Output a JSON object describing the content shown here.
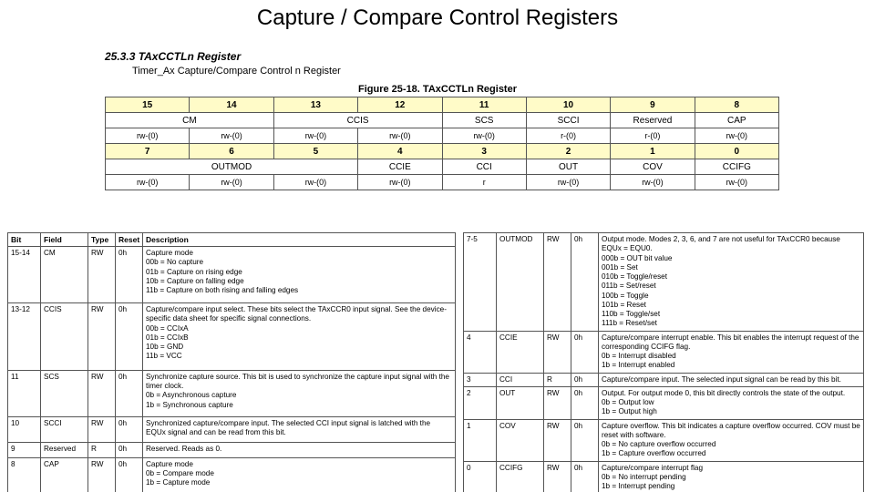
{
  "title": "Capture / Compare Control Registers",
  "section_num": "25.3.3   TAxCCTLn Register",
  "section_sub": "Timer_Ax Capture/Compare Control n Register",
  "figure_caption": "Figure 25-18. TAxCCTLn Register",
  "reg_high": {
    "bits": [
      "15",
      "14",
      "13",
      "12",
      "11",
      "10",
      "9",
      "8"
    ],
    "fields": [
      {
        "label": "CM",
        "span": 2
      },
      {
        "label": "CCIS",
        "span": 2
      },
      {
        "label": "SCS",
        "span": 1
      },
      {
        "label": "SCCI",
        "span": 1
      },
      {
        "label": "Reserved",
        "span": 1
      },
      {
        "label": "CAP",
        "span": 1
      }
    ],
    "access": [
      "rw-(0)",
      "rw-(0)",
      "rw-(0)",
      "rw-(0)",
      "rw-(0)",
      "r-(0)",
      "r-(0)",
      "rw-(0)"
    ]
  },
  "reg_low": {
    "bits": [
      "7",
      "6",
      "5",
      "4",
      "3",
      "2",
      "1",
      "0"
    ],
    "fields": [
      {
        "label": "OUTMOD",
        "span": 3
      },
      {
        "label": "CCIE",
        "span": 1
      },
      {
        "label": "CCI",
        "span": 1
      },
      {
        "label": "OUT",
        "span": 1
      },
      {
        "label": "COV",
        "span": 1
      },
      {
        "label": "CCIFG",
        "span": 1
      }
    ],
    "access": [
      "rw-(0)",
      "rw-(0)",
      "rw-(0)",
      "rw-(0)",
      "r",
      "rw-(0)",
      "rw-(0)",
      "rw-(0)"
    ]
  },
  "desc_headers": [
    "Bit",
    "Field",
    "Type",
    "Reset",
    "Description"
  ],
  "desc_left": [
    {
      "bit": "15-14",
      "field": "CM",
      "type": "RW",
      "reset": "0h",
      "lines": [
        "Capture mode",
        "00b = No capture",
        "01b = Capture on rising edge",
        "10b = Capture on falling edge",
        "11b = Capture on both rising and falling edges"
      ]
    },
    {
      "bit": "13-12",
      "field": "CCIS",
      "type": "RW",
      "reset": "0h",
      "lines": [
        "Capture/compare input select. These bits select the TAxCCR0 input signal. See the device-specific data sheet for specific signal connections.",
        "00b = CCIxA",
        "01b = CCIxB",
        "10b = GND",
        "11b = VCC"
      ]
    },
    {
      "bit": "11",
      "field": "SCS",
      "type": "RW",
      "reset": "0h",
      "lines": [
        "Synchronize capture source. This bit is used to synchronize the capture input signal with the timer clock.",
        "0b = Asynchronous capture",
        "1b = Synchronous capture"
      ]
    },
    {
      "bit": "10",
      "field": "SCCI",
      "type": "RW",
      "reset": "0h",
      "lines": [
        "Synchronized capture/compare input. The selected CCI input signal is latched with the EQUx signal and can be read from this bit."
      ]
    },
    {
      "bit": "9",
      "field": "Reserved",
      "type": "R",
      "reset": "0h",
      "lines": [
        "Reserved. Reads as 0."
      ]
    },
    {
      "bit": "8",
      "field": "CAP",
      "type": "RW",
      "reset": "0h",
      "lines": [
        "Capture mode",
        "0b = Compare mode",
        "1b = Capture mode"
      ]
    }
  ],
  "desc_right": [
    {
      "bit": "7-5",
      "field": "OUTMOD",
      "type": "RW",
      "reset": "0h",
      "lines": [
        "Output mode. Modes 2, 3, 6, and 7 are not useful for TAxCCR0 because EQUx = EQU0.",
        "000b = OUT bit value",
        "001b = Set",
        "010b = Toggle/reset",
        "011b = Set/reset",
        "100b = Toggle",
        "101b = Reset",
        "110b = Toggle/set",
        "111b = Reset/set"
      ]
    },
    {
      "bit": "4",
      "field": "CCIE",
      "type": "RW",
      "reset": "0h",
      "lines": [
        "Capture/compare interrupt enable. This bit enables the interrupt request of the corresponding CCIFG flag.",
        "0b = Interrupt disabled",
        "1b = Interrupt enabled"
      ]
    },
    {
      "bit": "3",
      "field": "CCI",
      "type": "R",
      "reset": "0h",
      "lines": [
        "Capture/compare input. The selected input signal can be read by this bit."
      ]
    },
    {
      "bit": "2",
      "field": "OUT",
      "type": "RW",
      "reset": "0h",
      "lines": [
        "Output. For output mode 0, this bit directly controls the state of the output.",
        "0b = Output low",
        "1b = Output high"
      ]
    },
    {
      "bit": "1",
      "field": "COV",
      "type": "RW",
      "reset": "0h",
      "lines": [
        "Capture overflow. This bit indicates a capture overflow occurred. COV must be reset with software.",
        "0b = No capture overflow occurred",
        "1b = Capture overflow occurred"
      ]
    },
    {
      "bit": "0",
      "field": "CCIFG",
      "type": "RW",
      "reset": "0h",
      "lines": [
        "Capture/compare interrupt flag",
        "0b = No interrupt pending",
        "1b = Interrupt pending"
      ]
    }
  ]
}
